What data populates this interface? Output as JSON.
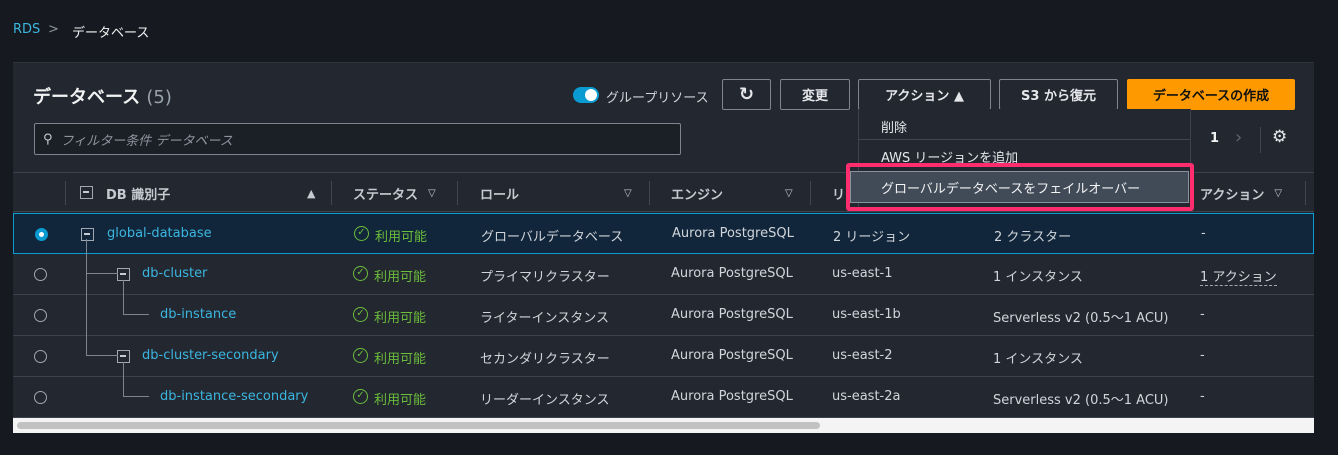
{
  "breadcrumb": {
    "root": "RDS",
    "current": "データベース"
  },
  "header": {
    "title": "データベース",
    "count": "(5)",
    "group_toggle_label": "グループリソース",
    "modify": "変更",
    "actions": "アクション ▲",
    "restore_s3": "S3 から復元",
    "create": "データベースの作成"
  },
  "filter": {
    "placeholder": "フィルター条件 データベース"
  },
  "pagination": {
    "page": "1"
  },
  "actions_menu": {
    "items": [
      "削除",
      "AWS リージョンを追加",
      "グローバルデータベースをフェイルオーバー"
    ]
  },
  "columns": {
    "id": "DB 識別子",
    "status": "ステータス",
    "role": "ロール",
    "engine": "エンジン",
    "region": "リ",
    "actions": "アクション"
  },
  "rows": [
    {
      "id": "global-database",
      "status": "利用可能",
      "role": "グローバルデータベース",
      "engine": "Aurora PostgreSQL",
      "region": "2 リージョン",
      "size": "2 クラスター",
      "actions": "-"
    },
    {
      "id": "db-cluster",
      "status": "利用可能",
      "role": "プライマリクラスター",
      "engine": "Aurora PostgreSQL",
      "region": "us-east-1",
      "size": "1 インスタンス",
      "actions": "1 アクション"
    },
    {
      "id": "db-instance",
      "status": "利用可能",
      "role": "ライターインスタンス",
      "engine": "Aurora PostgreSQL",
      "region": "us-east-1b",
      "size": "Serverless v2 (0.5〜1 ACU)",
      "actions": "-"
    },
    {
      "id": "db-cluster-secondary",
      "status": "利用可能",
      "role": "セカンダリクラスター",
      "engine": "Aurora PostgreSQL",
      "region": "us-east-2",
      "size": "1 インスタンス",
      "actions": "-"
    },
    {
      "id": "db-instance-secondary",
      "status": "利用可能",
      "role": "リーダーインスタンス",
      "engine": "Aurora PostgreSQL",
      "region": "us-east-2a",
      "size": "Serverless v2 (0.5〜1 ACU)",
      "actions": "-"
    }
  ],
  "colors": {
    "accent": "#0a9bd2",
    "primary": "#ff9900",
    "highlight": "#ff2d6e",
    "ok": "#6bbd3b"
  }
}
